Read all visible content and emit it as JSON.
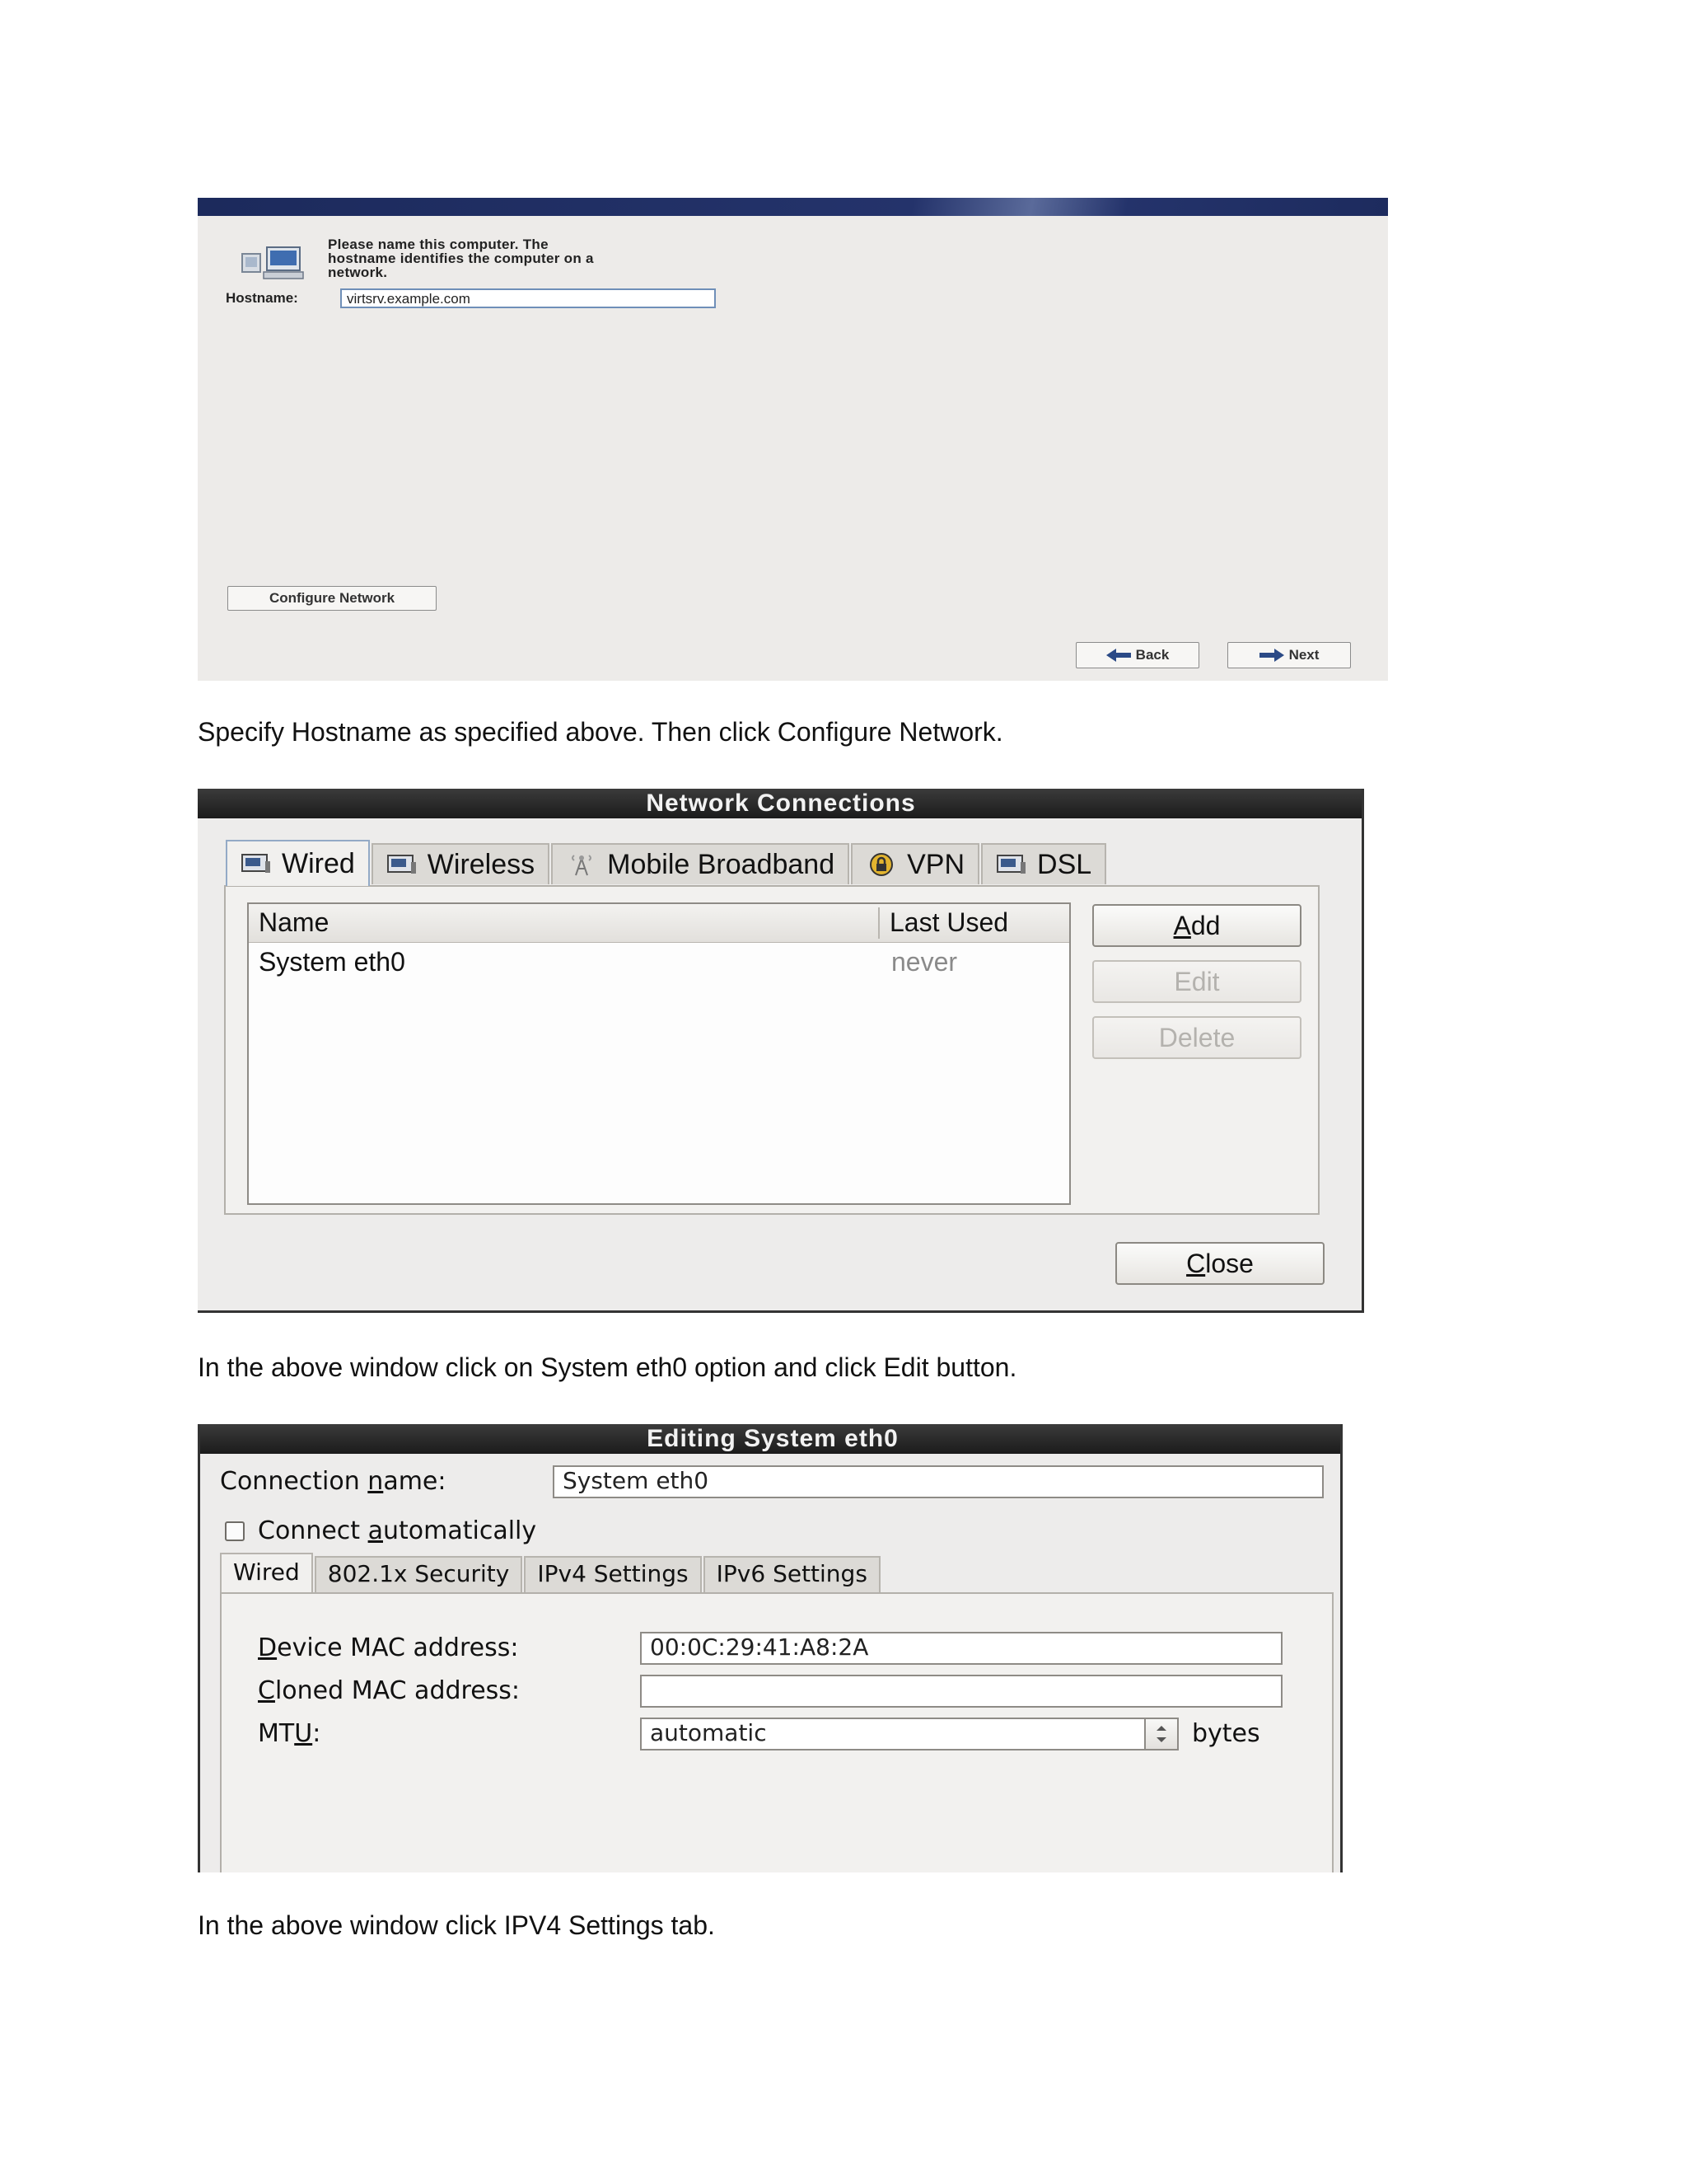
{
  "shot1": {
    "intro_lines": [
      "Please name this computer.  The",
      "hostname identifies the computer on a",
      "network."
    ],
    "hostname_label": "Hostname:",
    "hostname_value": "virtsrv.example.com",
    "configure_network_label": "Configure Network",
    "back_label": "Back",
    "next_label": "Next"
  },
  "captions": {
    "c1": "Specify Hostname as specified above. Then click Configure Network.",
    "c2": "In the above window click on System eth0 option and click Edit button.",
    "c3": "In the above window click IPV4 Settings tab."
  },
  "shot2": {
    "title": "Network Connections",
    "tabs": [
      {
        "label": "Wired",
        "icon": "network-card-icon"
      },
      {
        "label": "Wireless",
        "icon": "network-card-icon"
      },
      {
        "label": "Mobile Broadband",
        "icon": "antenna-icon"
      },
      {
        "label": "VPN",
        "icon": "lock-icon"
      },
      {
        "label": "DSL",
        "icon": "network-card-icon"
      }
    ],
    "columns": {
      "name": "Name",
      "last_used": "Last Used"
    },
    "rows": [
      {
        "name": "System eth0",
        "last_used": "never"
      }
    ],
    "buttons": {
      "add": "Add",
      "edit": "Edit",
      "delete": "Delete",
      "close": "Close"
    }
  },
  "shot3": {
    "title": "Editing System eth0",
    "connection_name_label": "Connection name:",
    "connection_name_value": "System eth0",
    "connect_automatically_label": "Connect automatically",
    "tabs": [
      "Wired",
      "802.1x Security",
      "IPv4 Settings",
      "IPv6 Settings"
    ],
    "device_mac_label": "Device MAC address:",
    "device_mac_value": "00:0C:29:41:A8:2A",
    "cloned_mac_label": "Cloned MAC address:",
    "cloned_mac_value": "",
    "mtu_label": "MTU:",
    "mtu_value": "automatic",
    "mtu_unit": "bytes"
  }
}
